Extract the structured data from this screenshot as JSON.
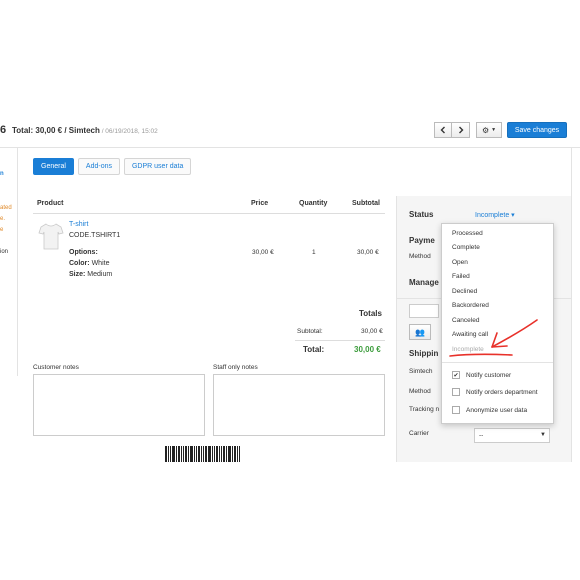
{
  "header": {
    "order_number": "6",
    "title": "Total: 30,00 € / Simtech",
    "date": " / 06/19/2018, 15:02",
    "prev_icon": "chevron-left-icon",
    "next_icon": "chevron-right-icon",
    "gear_icon": "gear-icon",
    "save_label": "Save changes"
  },
  "left_strip": {
    "lines": [
      "n",
      "ated",
      "e.",
      "e",
      "ion"
    ]
  },
  "tabs": [
    {
      "label": "General",
      "active": true
    },
    {
      "label": "Add-ons",
      "active": false
    },
    {
      "label": "GDPR user data",
      "active": false
    }
  ],
  "products": {
    "headers": {
      "product": "Product",
      "price": "Price",
      "quantity": "Quantity",
      "subtotal": "Subtotal"
    },
    "items": [
      {
        "name": "T-shirt",
        "code": "CODE.TSHIRT1",
        "options_label": "Options:",
        "color_label": "Color:",
        "color_value": "White",
        "size_label": "Size:",
        "size_value": "Medium",
        "price": "30,00 €",
        "quantity": "1",
        "subtotal": "30,00 €"
      }
    ]
  },
  "totals": {
    "title": "Totals",
    "subtotal_label": "Subtotal:",
    "subtotal_value": "30,00 €",
    "total_label": "Total:",
    "total_value": "30,00 €"
  },
  "notes": {
    "customer_label": "Customer notes",
    "staff_label": "Staff only notes"
  },
  "sidebar": {
    "status_label": "Status",
    "status_value": "Incomplete ▾",
    "payment_label": "Payme",
    "method_label": "Method",
    "manager_label": "Manage",
    "shipping_label": "Shippin",
    "shipping_carrier_name": "Simtech",
    "shipping_method_label": "Method",
    "tracking_label": "Tracking n",
    "carrier_label": "Carrier",
    "carrier_value": "--",
    "users_icon": "users-icon"
  },
  "status_dropdown": {
    "options": [
      {
        "label": "Processed",
        "disabled": false
      },
      {
        "label": "Complete",
        "disabled": false
      },
      {
        "label": "Open",
        "disabled": false
      },
      {
        "label": "Failed",
        "disabled": false
      },
      {
        "label": "Declined",
        "disabled": false
      },
      {
        "label": "Backordered",
        "disabled": false
      },
      {
        "label": "Canceled",
        "disabled": false
      },
      {
        "label": "Awaiting call",
        "disabled": false
      },
      {
        "label": "Incomplete",
        "disabled": true
      }
    ],
    "checks": [
      {
        "label": "Notify customer",
        "checked": true
      },
      {
        "label": "Notify orders department",
        "checked": false
      },
      {
        "label": "Anonymize user data",
        "checked": false
      }
    ]
  },
  "colors": {
    "accent": "#1a7ed6",
    "total_green": "#3c9c3c",
    "annotation_red": "#e8312a"
  }
}
